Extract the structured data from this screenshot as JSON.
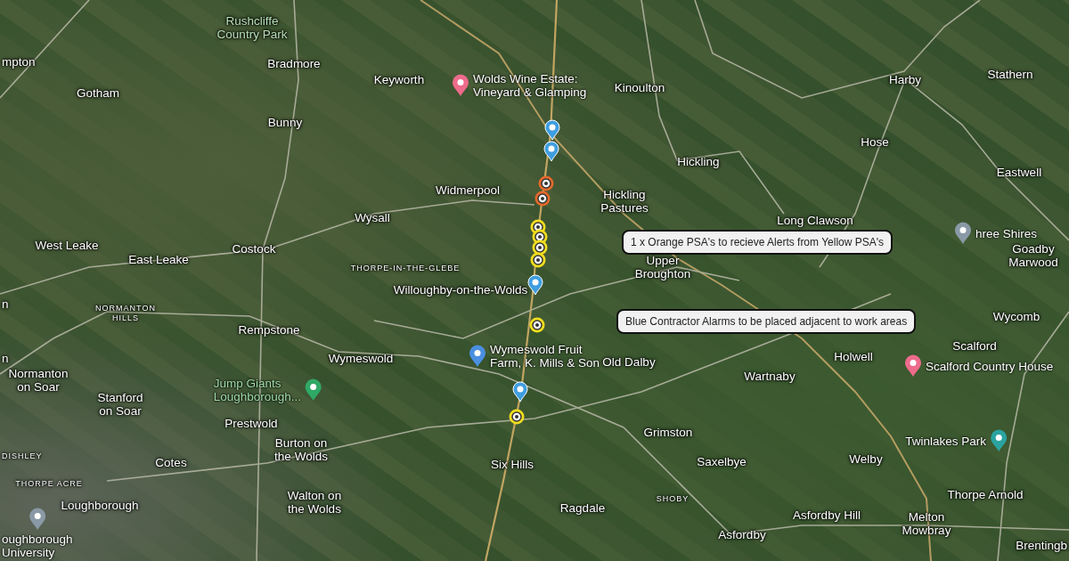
{
  "places": [
    {
      "name": "Rushcliffe\nCountry Park",
      "kind": "park"
    },
    {
      "name": "Bradmore",
      "kind": "town"
    },
    {
      "name": "Keyworth",
      "kind": "town"
    },
    {
      "name": "mpton",
      "kind": "town"
    },
    {
      "name": "Gotham",
      "kind": "town"
    },
    {
      "name": "Bunny",
      "kind": "town"
    },
    {
      "name": "Kinoulton",
      "kind": "town"
    },
    {
      "name": "Harby",
      "kind": "town"
    },
    {
      "name": "Stathern",
      "kind": "town"
    },
    {
      "name": "Hose",
      "kind": "town"
    },
    {
      "name": "Hickling",
      "kind": "town"
    },
    {
      "name": "Eastwell",
      "kind": "town"
    },
    {
      "name": "Widmerpool",
      "kind": "town"
    },
    {
      "name": "Hickling\nPastures",
      "kind": "town"
    },
    {
      "name": "Long Clawson",
      "kind": "town"
    },
    {
      "name": "Wysall",
      "kind": "town"
    },
    {
      "name": "West Leake",
      "kind": "town"
    },
    {
      "name": "Costock",
      "kind": "town"
    },
    {
      "name": "East Leake",
      "kind": "town"
    },
    {
      "name": "THORPE-IN-THE-GLEBE",
      "kind": "district"
    },
    {
      "name": "Goadby\nMarwood",
      "kind": "town"
    },
    {
      "name": "Upper\nBroughton",
      "kind": "town"
    },
    {
      "name": "Willoughby-on-the-Wolds",
      "kind": "town"
    },
    {
      "name": "NORMANTON\nHILLS",
      "kind": "district"
    },
    {
      "name": "Wycomb",
      "kind": "town"
    },
    {
      "name": "Rempstone",
      "kind": "town"
    },
    {
      "name": "Scalford",
      "kind": "town"
    },
    {
      "name": "Wymeswold",
      "kind": "town"
    },
    {
      "name": "Old Dalby",
      "kind": "town"
    },
    {
      "name": "Holwell",
      "kind": "town"
    },
    {
      "name": "Wartnaby",
      "kind": "town"
    },
    {
      "name": "n",
      "kind": "town"
    },
    {
      "name": "n",
      "kind": "town"
    },
    {
      "name": "Normanton\non Soar",
      "kind": "town"
    },
    {
      "name": "Stanford\non Soar",
      "kind": "town"
    },
    {
      "name": "Prestwold",
      "kind": "town"
    },
    {
      "name": "Grimston",
      "kind": "town"
    },
    {
      "name": "DISHLEY",
      "kind": "district"
    },
    {
      "name": "Burton on\nthe Wolds",
      "kind": "town"
    },
    {
      "name": "Cotes",
      "kind": "town"
    },
    {
      "name": "Six Hills",
      "kind": "town"
    },
    {
      "name": "Saxelbye",
      "kind": "town"
    },
    {
      "name": "Welby",
      "kind": "town"
    },
    {
      "name": "THORPE ACRE",
      "kind": "district"
    },
    {
      "name": "Loughborough",
      "kind": "town"
    },
    {
      "name": "Walton on\nthe Wolds",
      "kind": "town"
    },
    {
      "name": "Ragdale",
      "kind": "town"
    },
    {
      "name": "SHOBY",
      "kind": "district"
    },
    {
      "name": "Thorpe Arnold",
      "kind": "town"
    },
    {
      "name": "Asfordby Hill",
      "kind": "town"
    },
    {
      "name": "Melton\nMowbray",
      "kind": "town"
    },
    {
      "name": "Asfordby",
      "kind": "town"
    },
    {
      "name": "Brentingb",
      "kind": "town"
    }
  ],
  "pois": [
    {
      "name": "Wolds Wine Estate:\nVineyard & Glamping",
      "kind": "hotel"
    },
    {
      "name": "Wymeswold Fruit\nFarm, K. Mills & Son",
      "kind": "shop"
    },
    {
      "name": "Jump Giants\nLoughborough...",
      "kind": "attraction"
    },
    {
      "name": "hree Shires",
      "kind": "place"
    },
    {
      "name": "Scalford Country House",
      "kind": "hotel"
    },
    {
      "name": "Twinlakes Park",
      "kind": "park"
    },
    {
      "name": "oughborough\nUniversity",
      "kind": "school"
    }
  ],
  "markers": [
    {
      "kind": "pin",
      "color": "#3f9ee0"
    },
    {
      "kind": "pin",
      "color": "#3f9ee0"
    },
    {
      "kind": "alarm",
      "color": "#e2692a"
    },
    {
      "kind": "alarm",
      "color": "#e2692a"
    },
    {
      "kind": "alarm",
      "color": "#f1dd1f"
    },
    {
      "kind": "alarm",
      "color": "#f1dd1f"
    },
    {
      "kind": "alarm",
      "color": "#f1dd1f"
    },
    {
      "kind": "alarm",
      "color": "#f1dd1f"
    },
    {
      "kind": "pin",
      "color": "#3f9ee0"
    },
    {
      "kind": "alarm",
      "color": "#f1dd1f"
    },
    {
      "kind": "pin",
      "color": "#3f9ee0"
    },
    {
      "kind": "alarm",
      "color": "#f1dd1f"
    }
  ],
  "notes": [
    {
      "text": "1 x Orange PSA's to recieve Alerts from Yellow PSA's"
    },
    {
      "text": "Blue Contractor Alarms to be placed adjacent to work areas"
    }
  ]
}
